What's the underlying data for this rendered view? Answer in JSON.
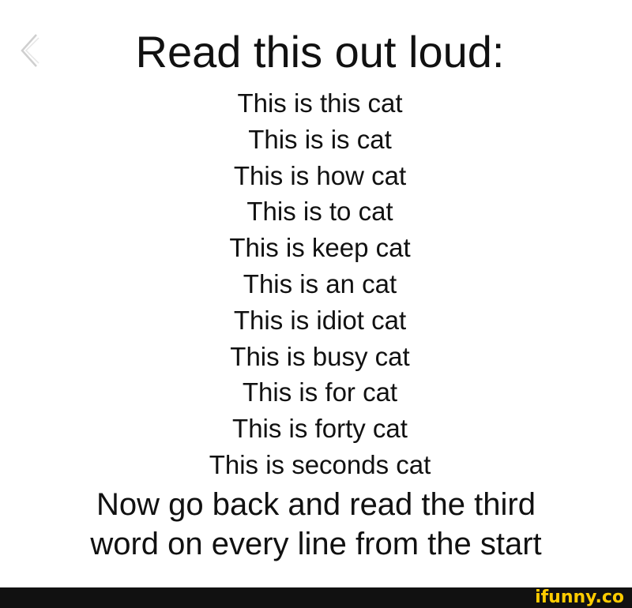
{
  "title": "Read this out loud:",
  "lines": [
    "This is this cat",
    "This is is cat",
    "This is how cat",
    "This is to cat",
    "This is keep cat",
    "This is an cat",
    "This is idiot cat",
    "This is busy cat",
    "This is for cat",
    "This is forty cat",
    "This is seconds cat"
  ],
  "instruction": {
    "line1": "Now go back and read the third",
    "line2": "word on every line from the start"
  },
  "watermark": "ifunny.co",
  "icons": {
    "back": "chevron-left-icon"
  },
  "colors": {
    "background": "#ffffff",
    "text": "#111111",
    "footer": "#111111",
    "watermark": "#ffcc00"
  }
}
